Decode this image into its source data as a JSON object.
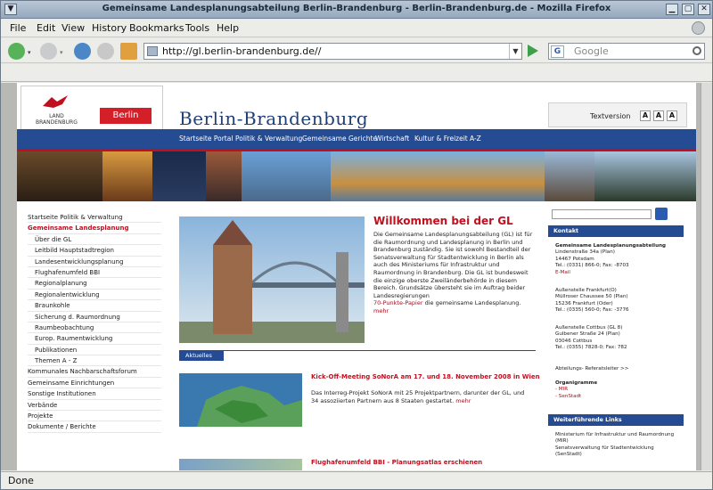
{
  "window": {
    "title": "Gemeinsame Landesplanungsabteilung Berlin-Brandenburg - Berlin-Brandenburg.de - Mozilla Firefox"
  },
  "menu": [
    "File",
    "Edit",
    "View",
    "History",
    "Bookmarks",
    "Tools",
    "Help"
  ],
  "toolbar": {
    "url": "http://gl.berlin-brandenburg.de//",
    "search_placeholder": "Google",
    "search_engine": "G"
  },
  "status": {
    "text": "Done"
  },
  "site": {
    "logo_left": "LAND\nBRANDENBURG",
    "logo_right": "Berlin",
    "brand_title": "Berlin-Brandenburg",
    "textversion": {
      "label": "Textversion",
      "sizes": [
        "A",
        "A",
        "A"
      ]
    },
    "topnav": [
      "Startseite Portal",
      "Politik & Verwaltung",
      "Gemeinsame Gerichte",
      "Wirtschaft",
      "Kultur & Freizeit",
      "A-Z"
    ],
    "leftnav": [
      {
        "label": "Startseite Politik & Verwaltung",
        "type": "normal"
      },
      {
        "label": "Gemeinsame Landesplanung",
        "type": "active"
      },
      {
        "label": "Über die GL",
        "type": "sub"
      },
      {
        "label": "Leitbild Hauptstadtregion",
        "type": "sub"
      },
      {
        "label": "Landesentwicklungsplanung",
        "type": "sub"
      },
      {
        "label": "Flughafenumfeld BBI",
        "type": "sub"
      },
      {
        "label": "Regionalplanung",
        "type": "sub"
      },
      {
        "label": "Regionalentwicklung",
        "type": "sub"
      },
      {
        "label": "Braunkohle",
        "type": "sub"
      },
      {
        "label": "Sicherung d. Raumordnung",
        "type": "sub"
      },
      {
        "label": "Raumbeobachtung",
        "type": "sub"
      },
      {
        "label": "Europ. Raumentwicklung",
        "type": "sub"
      },
      {
        "label": "Publikationen",
        "type": "sub"
      },
      {
        "label": "Themen A - Z",
        "type": "sub"
      },
      {
        "label": "Kommunales Nachbarschaftsforum",
        "type": "normal"
      },
      {
        "label": "Gemeinsame Einrichtungen",
        "type": "normal"
      },
      {
        "label": "Sonstige Institutionen",
        "type": "normal"
      },
      {
        "label": "Verbände",
        "type": "normal"
      },
      {
        "label": "Projekte",
        "type": "normal"
      },
      {
        "label": "Dokumente / Berichte",
        "type": "normal"
      }
    ],
    "welcome": {
      "title": "Willkommen bei der GL",
      "text": "Die Gemeinsame Landesplanungsabteilung (GL) ist für die Raumordnung und Landesplanung in Berlin und Brandenburg zuständig. Sie ist sowohl Bestandteil der Senatsverwaltung für Stadtentwicklung in Berlin als auch des Ministeriums für Infrastruktur und Raumordnung in Brandenburg. Die GL ist bundesweit die einzige oberste Zweiländerbehörde in diesem Bereich. Grundsätze übersteht sie im Auftrag beider Landesregierungen",
      "link": "70-Punkte-Papier",
      "link_tail": "die gemeinsame Landesplanung.",
      "more": "mehr"
    },
    "aktuelles": "Aktuelles",
    "news": [
      {
        "title": "Kick-Off-Meeting SoNorA am 17. und 18. November 2008 in Wien",
        "text": "Das Interreg-Projekt SoNorA mit 25 Projektpartnern, darunter der GL, und 34 assoziierten Partnern aus 8 Staaten gestartet.",
        "more": "mehr"
      },
      {
        "title": "Flughafenumfeld BBI - Planungsatlas erschienen"
      }
    ],
    "right": {
      "kontakt_head": "Kontakt",
      "kontakt1": [
        "Gemeinsame Landesplanungsabteilung",
        "Lindenstraße 34a (Plan)",
        "14467 Potsdam",
        "Tel.: (0331) 866-0; Fax: -8703",
        "E-Mail"
      ],
      "kontakt2": [
        "Außenstelle Frankfurt(O)",
        "Müllroser Chaussee 50 (Plan)",
        "15236 Frankfurt (Oder)",
        "Tel.: (0335) 560-0; Fax: -3776"
      ],
      "kontakt3": [
        "Außenstelle Cottbus (GL 8)",
        "Gulbener Straße 24 (Plan)",
        "03046 Cottbus",
        "Tel.: (0355) 7828-0; Fax: 782"
      ],
      "abteilung": "Abteilungs- Referatsleiter >>",
      "organigramme_head": "Organigramme",
      "organigramme": [
        "- MIR",
        "- SenStadt"
      ],
      "links_head": "Weiterführende Links",
      "links": [
        "Ministerium für Infrastruktur und Raumordnung (MIR)",
        "Senatsverwaltung für Stadtentwicklung (SenStadt)"
      ]
    }
  },
  "colors": {
    "brand_blue": "#254c93",
    "brand_red": "#c01020"
  }
}
